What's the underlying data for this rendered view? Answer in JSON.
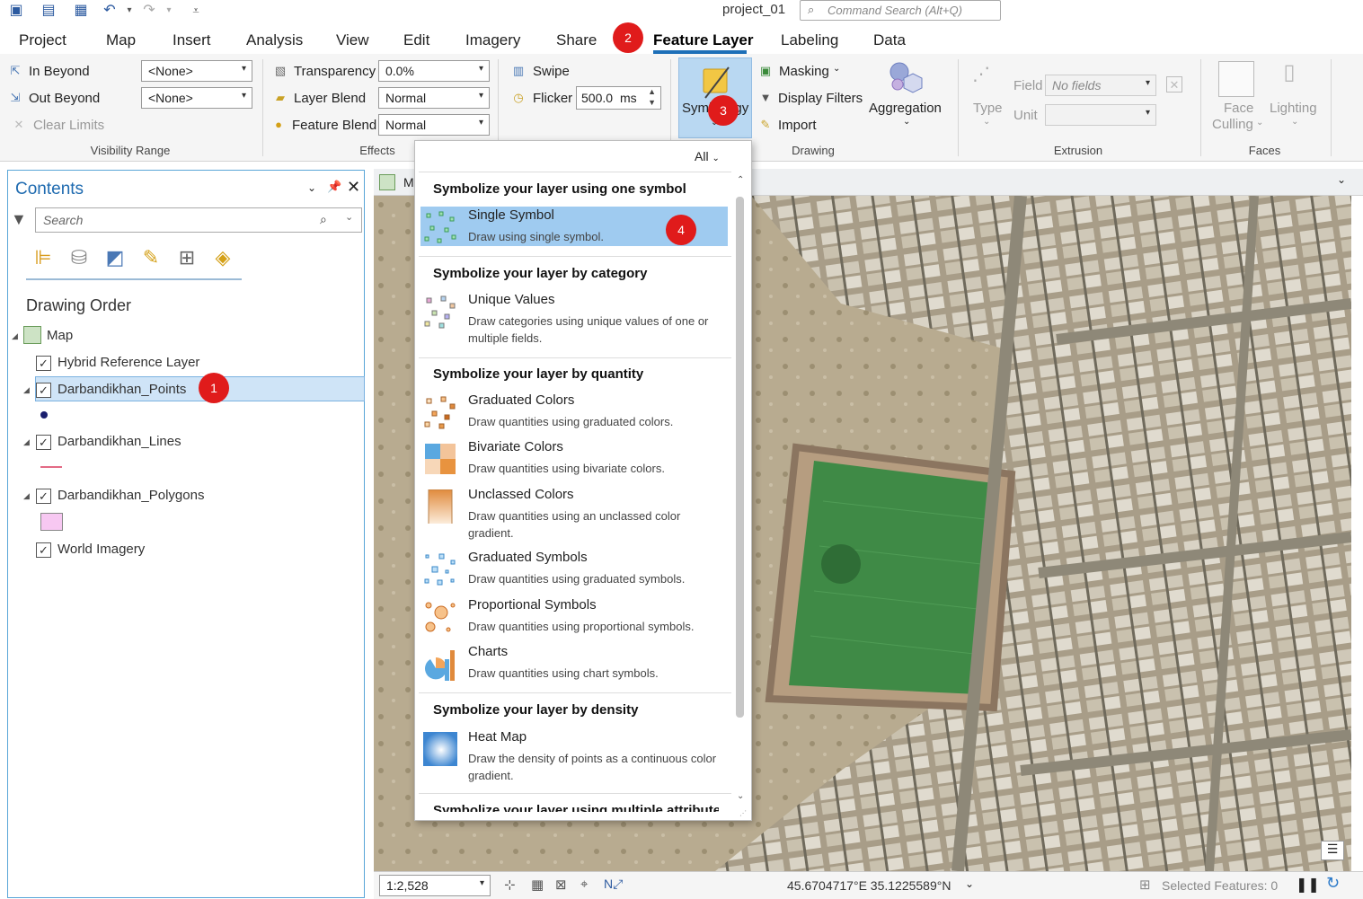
{
  "titlebar": {
    "project": "project_01",
    "command_search": "Command Search (Alt+Q)"
  },
  "menu": {
    "tabs": [
      "Project",
      "Map",
      "Insert",
      "Analysis",
      "View",
      "Edit",
      "Imagery",
      "Share",
      "Feature Layer",
      "Labeling",
      "Data"
    ],
    "active": "Feature Layer"
  },
  "ribbon": {
    "visibility": {
      "in_beyond": "In Beyond",
      "out_beyond": "Out Beyond",
      "clear_limits": "Clear Limits",
      "in_value": "<None>",
      "out_value": "<None>",
      "group": "Visibility Range"
    },
    "effects": {
      "transparency": "Transparency",
      "transparency_value": "0.0%",
      "layer_blend": "Layer Blend",
      "layer_blend_value": "Normal",
      "feature_blend": "Feature Blend",
      "feature_blend_value": "Normal",
      "swipe": "Swipe",
      "flicker": "Flicker",
      "flicker_value": "500.0",
      "flicker_unit": "ms",
      "group": "Effects"
    },
    "drawing": {
      "symbology": "Symbology",
      "masking": "Masking",
      "display_filters": "Display Filters",
      "import": "Import",
      "aggregation": "Aggregation",
      "group": "Drawing"
    },
    "extrusion": {
      "type": "Type",
      "field": "Field",
      "field_value": "No fields",
      "unit": "Unit",
      "group": "Extrusion"
    },
    "faces": {
      "face_culling_1": "Face",
      "face_culling_2": "Culling",
      "lighting": "Lighting",
      "group": "Faces"
    }
  },
  "badges": [
    "1",
    "2",
    "3",
    "4"
  ],
  "contents": {
    "title": "Contents",
    "search_placeholder": "Search",
    "drawing_order": "Drawing Order",
    "layers": {
      "map": "Map",
      "hybrid": "Hybrid Reference Layer",
      "points": "Darbandikhan_Points",
      "lines": "Darbandikhan_Lines",
      "polygons": "Darbandikhan_Polygons",
      "imagery": "World Imagery"
    }
  },
  "map": {
    "tab": "M",
    "scale": "1:2,528",
    "coords": "45.6704717°E 35.1225589°N",
    "selected": "Selected Features: 0"
  },
  "popup": {
    "filter": "All",
    "sections": {
      "one": "Symbolize your layer using one symbol",
      "category": "Symbolize your layer by category",
      "quantity": "Symbolize your layer by quantity",
      "density": "Symbolize your layer by density",
      "multiple": "Symbolize your layer using multiple attributes"
    },
    "options": {
      "single": {
        "title": "Single Symbol",
        "desc": "Draw using single symbol."
      },
      "unique": {
        "title": "Unique Values",
        "desc": "Draw categories using unique values of one or multiple fields."
      },
      "grad_colors": {
        "title": "Graduated Colors",
        "desc": "Draw quantities using graduated colors."
      },
      "bivariate": {
        "title": "Bivariate Colors",
        "desc": "Draw quantities using bivariate colors."
      },
      "unclassed": {
        "title": "Unclassed Colors",
        "desc": "Draw quantities using an unclassed color gradient."
      },
      "grad_symbols": {
        "title": "Graduated Symbols",
        "desc": "Draw quantities using graduated symbols."
      },
      "proportional": {
        "title": "Proportional Symbols",
        "desc": "Draw quantities using proportional symbols."
      },
      "charts": {
        "title": "Charts",
        "desc": "Draw quantities using chart symbols."
      },
      "heatmap": {
        "title": "Heat Map",
        "desc": "Draw the density of points as a continuous color gradient."
      }
    }
  }
}
